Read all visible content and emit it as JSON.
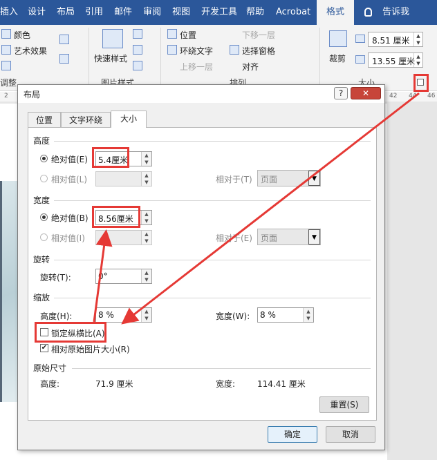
{
  "ribbon_tabs": [
    {
      "label": "插入",
      "active": false
    },
    {
      "label": "设计",
      "active": false
    },
    {
      "label": "布局",
      "active": false
    },
    {
      "label": "引用",
      "active": false
    },
    {
      "label": "邮件",
      "active": false
    },
    {
      "label": "审阅",
      "active": false
    },
    {
      "label": "视图",
      "active": false
    },
    {
      "label": "开发工具",
      "active": false
    },
    {
      "label": "帮助",
      "active": false
    },
    {
      "label": "Acrobat",
      "active": false
    },
    {
      "label": "格式",
      "active": true
    }
  ],
  "tell_me": "告诉我",
  "ribbon": {
    "color": "颜色",
    "art_effect": "艺术效果",
    "adjust_group": "调整",
    "quick_styles": "快速样式",
    "picture_styles_group": "图片样式",
    "position": "位置",
    "wrap_text": "环绕文字",
    "bring_forward": "上移一层",
    "send_backward": "下移一层",
    "selection_pane": "选择窗格",
    "align": "对齐",
    "arrange_group": "排列",
    "crop": "裁剪",
    "height_value": "8.51 厘米",
    "width_value": "13.55 厘米",
    "size_group": "大小"
  },
  "ruler": [
    "2",
    "42",
    "44",
    "46"
  ],
  "dialog": {
    "title": "布局",
    "help": "?",
    "close": "✕",
    "tabs": [
      {
        "label": "位置",
        "selected": false
      },
      {
        "label": "文字环绕",
        "selected": false
      },
      {
        "label": "大小",
        "selected": true
      }
    ],
    "height_section": {
      "title": "高度",
      "absolute_label": "绝对值(E)",
      "absolute_value": "5.4厘米",
      "relative_label": "相对值(L)",
      "relative_to_label": "相对于(T)",
      "relative_to_value": "页面"
    },
    "width_section": {
      "title": "宽度",
      "absolute_label": "绝对值(B)",
      "absolute_value": "8.56厘米",
      "relative_label": "相对值(I)",
      "relative_to_label": "相对于(E)",
      "relative_to_value": "页面"
    },
    "rotate_section": {
      "title": "旋转",
      "rotation_label": "旋转(T):",
      "rotation_value": "0°"
    },
    "scale_section": {
      "title": "缩放",
      "height_label": "高度(H):",
      "height_value": "8 %",
      "width_label": "宽度(W):",
      "width_value": "8 %",
      "lock_aspect_label": "锁定纵横比(A)",
      "lock_aspect_checked": false,
      "relative_original_label": "相对原始图片大小(R)",
      "relative_original_checked": true
    },
    "original_section": {
      "title": "原始尺寸",
      "height_label": "高度:",
      "height_value": "71.9 厘米",
      "width_label": "宽度:",
      "width_value": "114.41 厘米"
    },
    "reset_button": "重置(S)",
    "ok_button": "确定",
    "cancel_button": "取消"
  },
  "colors": {
    "ribbon_blue": "#2b579a",
    "annotation_red": "#e53935"
  }
}
